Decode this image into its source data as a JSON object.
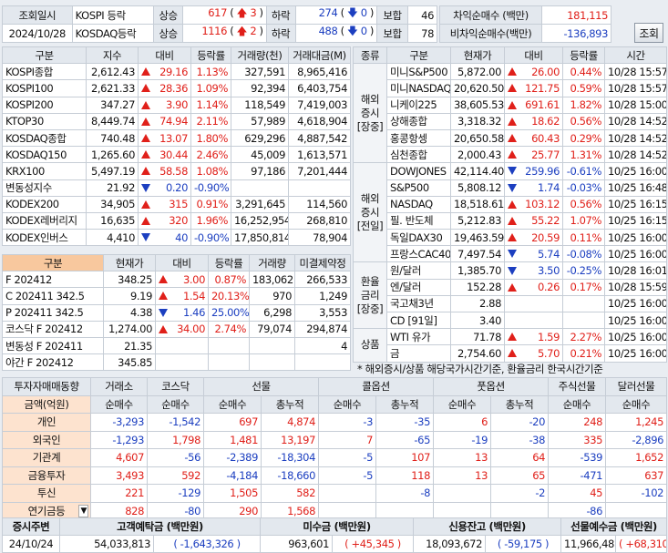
{
  "top": {
    "query_date_label": "조회일시",
    "date": "2024/10/28",
    "markets": [
      {
        "name": "KOSPI 등락",
        "up_label": "상승",
        "up": "617",
        "up_limit": "3",
        "down_label": "하락",
        "down": "274",
        "down_limit": "0",
        "flat_label": "보합",
        "flat": "46"
      },
      {
        "name": "KOSDAQ등락",
        "up_label": "상승",
        "up": "1116",
        "up_limit": "2",
        "down_label": "하락",
        "down": "488",
        "down_limit": "0",
        "flat_label": "보합",
        "flat": "78"
      }
    ],
    "arb_label": "차익순매수 (백만)",
    "arb": "181,115",
    "nonarb_label": "비차익순매수(백만)",
    "nonarb": "-136,893",
    "query_button": "조회"
  },
  "index": {
    "headers": [
      "구분",
      "지수",
      "대비",
      "등락률",
      "거래량(천)",
      "거래대금(M)"
    ],
    "rows": [
      {
        "name": "KOSPI종합",
        "value": "2,612.43",
        "dir": "up",
        "chg": "29.16",
        "rate": "1.13%",
        "vol": "327,591",
        "amt": "8,965,416"
      },
      {
        "name": "KOSPI100",
        "value": "2,621.33",
        "dir": "up",
        "chg": "28.36",
        "rate": "1.09%",
        "vol": "92,394",
        "amt": "6,403,754"
      },
      {
        "name": "KOSPI200",
        "value": "347.27",
        "dir": "up",
        "chg": "3.90",
        "rate": "1.14%",
        "vol": "118,549",
        "amt": "7,419,003"
      },
      {
        "name": "KTOP30",
        "value": "8,449.74",
        "dir": "up",
        "chg": "74.94",
        "rate": "2.11%",
        "vol": "57,989",
        "amt": "4,618,904"
      },
      {
        "name": "KOSDAQ종합",
        "value": "740.48",
        "dir": "up",
        "chg": "13.07",
        "rate": "1.80%",
        "vol": "629,296",
        "amt": "4,887,542"
      },
      {
        "name": "KOSDAQ150",
        "value": "1,265.60",
        "dir": "up",
        "chg": "30.44",
        "rate": "2.46%",
        "vol": "45,009",
        "amt": "1,613,571"
      },
      {
        "name": "KRX100",
        "value": "5,497.19",
        "dir": "up",
        "chg": "58.58",
        "rate": "1.08%",
        "vol": "97,186",
        "amt": "7,201,444"
      },
      {
        "name": "변동성지수",
        "value": "21.92",
        "dir": "dn",
        "chg": "0.20",
        "rate": "-0.90%",
        "vol": "",
        "amt": ""
      },
      {
        "name": "KODEX200",
        "value": "34,905",
        "dir": "up",
        "chg": "315",
        "rate": "0.91%",
        "vol": "3,291,645",
        "amt": "114,560"
      },
      {
        "name": "KODEX레버리지",
        "value": "16,635",
        "dir": "up",
        "chg": "320",
        "rate": "1.96%",
        "vol": "16,252,954",
        "amt": "268,810"
      },
      {
        "name": "KODEX인버스",
        "value": "4,410",
        "dir": "dn",
        "chg": "40",
        "rate": "-0.90%",
        "vol": "17,850,814",
        "amt": "78,904"
      }
    ]
  },
  "futures": {
    "headers": [
      "구분",
      "현재가",
      "대비",
      "등락률",
      "거래량",
      "미결제약정"
    ],
    "rows": [
      {
        "name": "F 202412",
        "value": "348.25",
        "dir": "up",
        "chg": "3.00",
        "rate": "0.87%",
        "vol": "183,062",
        "oi": "266,533"
      },
      {
        "name": "C 202411 342.5",
        "value": "9.19",
        "dir": "up",
        "chg": "1.54",
        "rate": "20.13%",
        "vol": "970",
        "oi": "1,249"
      },
      {
        "name": "P 202411 342.5",
        "value": "4.38",
        "dir": "dn",
        "chg": "1.46",
        "rate": "25.00%",
        "vol": "6,298",
        "oi": "3,553"
      },
      {
        "name": "코스닥 F 202412",
        "value": "1,274.00",
        "dir": "up",
        "chg": "34.00",
        "rate": "2.74%",
        "vol": "79,074",
        "oi": "294,874"
      },
      {
        "name": "변동성 F 202411",
        "value": "21.35",
        "dir": "",
        "chg": "",
        "rate": "",
        "vol": "",
        "oi": "4"
      },
      {
        "name": "야간 F 202412",
        "value": "345.85",
        "dir": "",
        "chg": "",
        "rate": "",
        "vol": "",
        "oi": ""
      }
    ]
  },
  "global": {
    "headers": [
      "종류",
      "구분",
      "현재가",
      "대비",
      "등락률",
      "시간"
    ],
    "groups": [
      {
        "label": "해외증시[장중]",
        "rows": [
          {
            "name": "미니S&P500",
            "value": "5,872.00",
            "dir": "up",
            "chg": "26.00",
            "rate": "0.44%",
            "time": "10/28 15:57"
          },
          {
            "name": "미니NASDAQ",
            "value": "20,620.50",
            "dir": "up",
            "chg": "121.75",
            "rate": "0.59%",
            "time": "10/28 15:57"
          },
          {
            "name": "니케이225",
            "value": "38,605.53",
            "dir": "up",
            "chg": "691.61",
            "rate": "1.82%",
            "time": "10/28 15:00"
          },
          {
            "name": "상해종합",
            "value": "3,318.32",
            "dir": "up",
            "chg": "18.62",
            "rate": "0.56%",
            "time": "10/28 14:52"
          },
          {
            "name": "홍콩항셍",
            "value": "20,650.58",
            "dir": "up",
            "chg": "60.43",
            "rate": "0.29%",
            "time": "10/28 14:52"
          },
          {
            "name": "심천종합",
            "value": "2,000.43",
            "dir": "up",
            "chg": "25.77",
            "rate": "1.31%",
            "time": "10/28 14:52"
          }
        ]
      },
      {
        "label": "해외증시[전일]",
        "rows": [
          {
            "name": "DOWJONES",
            "value": "42,114.40",
            "dir": "dn",
            "chg": "259.96",
            "rate": "-0.61%",
            "time": "10/25 16:00"
          },
          {
            "name": "S&P500",
            "value": "5,808.12",
            "dir": "dn",
            "chg": "1.74",
            "rate": "-0.03%",
            "time": "10/25 16:48"
          },
          {
            "name": "NASDAQ",
            "value": "18,518.61",
            "dir": "up",
            "chg": "103.12",
            "rate": "0.56%",
            "time": "10/25 16:15"
          },
          {
            "name": "필. 반도체",
            "value": "5,212.83",
            "dir": "up",
            "chg": "55.22",
            "rate": "1.07%",
            "time": "10/25 16:15"
          },
          {
            "name": "독일DAX30",
            "value": "19,463.59",
            "dir": "up",
            "chg": "20.59",
            "rate": "0.11%",
            "time": "10/25 16:00"
          },
          {
            "name": "프랑스CAC40",
            "value": "7,497.54",
            "dir": "dn",
            "chg": "5.74",
            "rate": "-0.08%",
            "time": "10/25 16:00"
          }
        ]
      },
      {
        "label": "환율금리[장중]",
        "rows": [
          {
            "name": "원/달러",
            "value": "1,385.70",
            "dir": "dn",
            "chg": "3.50",
            "rate": "-0.25%",
            "time": "10/28 16:01"
          },
          {
            "name": "엔/달러",
            "value": "152.28",
            "dir": "up",
            "chg": "0.26",
            "rate": "0.17%",
            "time": "10/28 15:59"
          },
          {
            "name": "국고채3년",
            "value": "2.88",
            "dir": "",
            "chg": "",
            "rate": "",
            "time": "10/25 16:00"
          },
          {
            "name": "CD [91일]",
            "value": "3.40",
            "dir": "",
            "chg": "",
            "rate": "",
            "time": "10/25 16:00"
          }
        ]
      },
      {
        "label": "상품",
        "rows": [
          {
            "name": "WTI 유가",
            "value": "71.78",
            "dir": "up",
            "chg": "1.59",
            "rate": "2.27%",
            "time": "10/25 16:00"
          },
          {
            "name": "금",
            "value": "2,754.60",
            "dir": "up",
            "chg": "5.70",
            "rate": "0.21%",
            "time": "10/25 16:00"
          }
        ]
      }
    ],
    "note": "* 해외증시/상품 해당국가시간기준, 환율금리 한국시간기준"
  },
  "investor": {
    "title": "투자자매매동향",
    "groups": [
      "거래소",
      "코스닥",
      "선물",
      "콜옵션",
      "풋옵션",
      "주식선물",
      "달러선물"
    ],
    "unit_label": "금액(억원)",
    "sub": [
      "순매수",
      "순매수",
      "순매수",
      "총누적",
      "순매수",
      "총누적",
      "순매수",
      "총누적",
      "순매수",
      "순매수"
    ],
    "rows": [
      {
        "name": "개인",
        "v": [
          "-3,293",
          "-1,542",
          "697",
          "4,874",
          "-3",
          "-35",
          "6",
          "-20",
          "248",
          "1,245"
        ]
      },
      {
        "name": "외국인",
        "v": [
          "-1,293",
          "1,798",
          "1,481",
          "13,197",
          "7",
          "-65",
          "-19",
          "-38",
          "335",
          "-2,896"
        ]
      },
      {
        "name": "기관계",
        "v": [
          "4,607",
          "-56",
          "-2,389",
          "-18,304",
          "-5",
          "107",
          "13",
          "64",
          "-539",
          "1,652"
        ]
      },
      {
        "name": "금융투자",
        "v": [
          "3,493",
          "592",
          "-4,184",
          "-18,660",
          "-5",
          "118",
          "13",
          "65",
          "-471",
          "637"
        ]
      },
      {
        "name": "투신",
        "v": [
          "221",
          "-129",
          "1,505",
          "582",
          "",
          "-8",
          "",
          "-2",
          "45",
          "-102"
        ]
      },
      {
        "name": "연기금등",
        "v": [
          "828",
          "-80",
          "290",
          "1,568",
          "",
          "",
          "",
          "",
          "-86",
          ""
        ]
      }
    ]
  },
  "credit": {
    "headers": [
      "증시주변",
      "고객예탁금 (백만원)",
      "미수금 (백만원)",
      "신용잔고 (백만원)",
      "선물예수금 (백만원)"
    ],
    "date": "24/10/24",
    "deposit": "54,033,813",
    "deposit_chg": "( -1,643,326 )",
    "receivable": "963,601",
    "receivable_chg": "( +45,345 )",
    "credit": "18,093,672",
    "credit_chg": "( -59,175 )",
    "fut_deposit": "11,966,487",
    "fut_deposit_chg": "( +68,310 )"
  }
}
